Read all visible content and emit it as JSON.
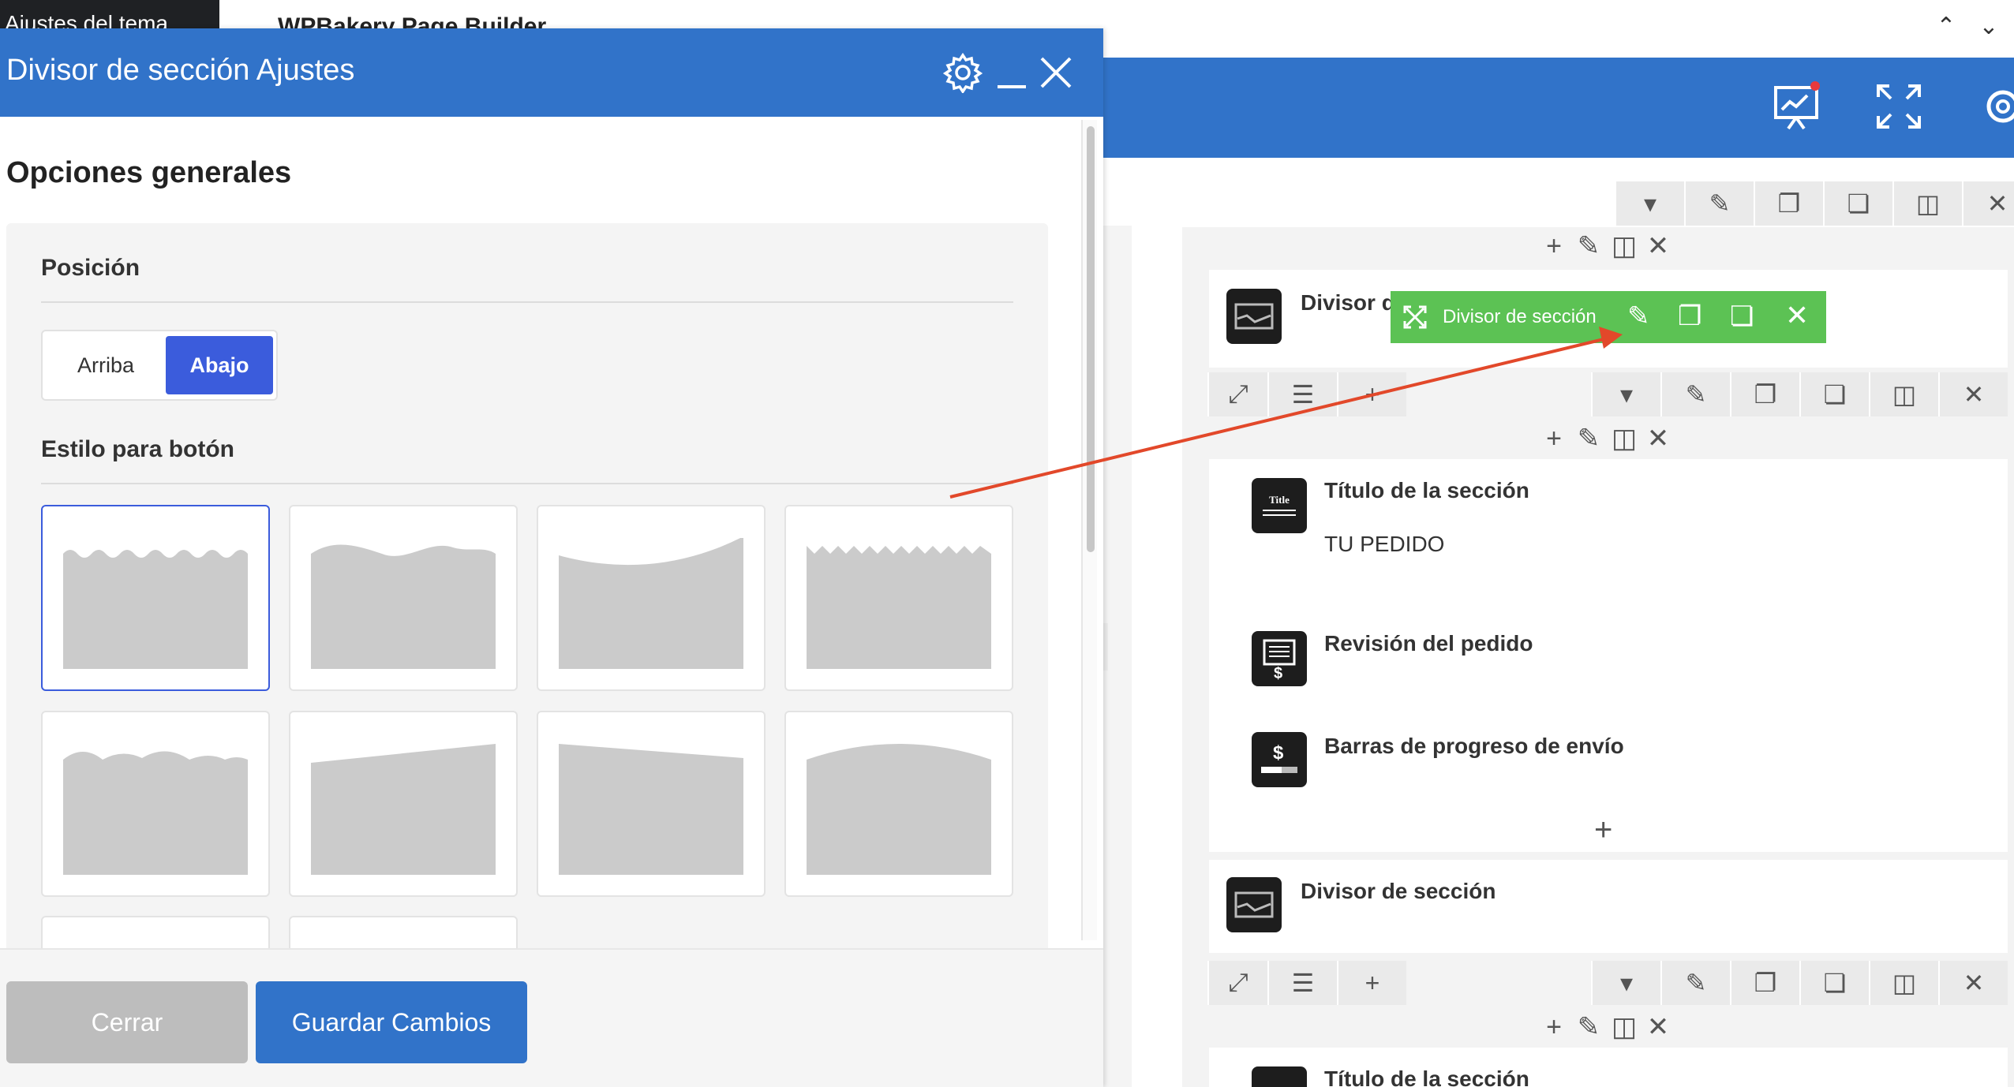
{
  "admin_bar": {
    "dark_tab_label": "Ajustes del tema",
    "builder_title": "WPBakery Page Builder"
  },
  "panel": {
    "title": "Divisor de sección Ajustes",
    "section_title": "Opciones generales",
    "position_label": "Posición",
    "position_options": [
      "Arriba",
      "Abajo"
    ],
    "position_selected": "Abajo",
    "button_style_label": "Estilo para botón",
    "style_names": [
      "waves-small",
      "wave-soft",
      "curve-rise",
      "zigzag",
      "clouds",
      "slope-up",
      "slope-down",
      "arch"
    ],
    "selected_style_index": 0,
    "close_label": "Cerrar",
    "save_label": "Guardar Cambios"
  },
  "builder": {
    "green_toolbar_label": "Divisor de sección",
    "element_top_label": "Divisor d",
    "section_title_label": "Título de la sección",
    "section_title_text": "TU PEDIDO",
    "order_review_label": "Revisión del pedido",
    "shipping_bar_label": "Barras de progreso de envío",
    "divider_label": "Divisor de sección",
    "section_title_bottom_label": "Título de la sección",
    "title_icon_text": "Title"
  },
  "colors": {
    "primary": "#3173c9",
    "accent": "#3b5cdc",
    "green": "#5cc254",
    "arrow": "#e2482a"
  }
}
